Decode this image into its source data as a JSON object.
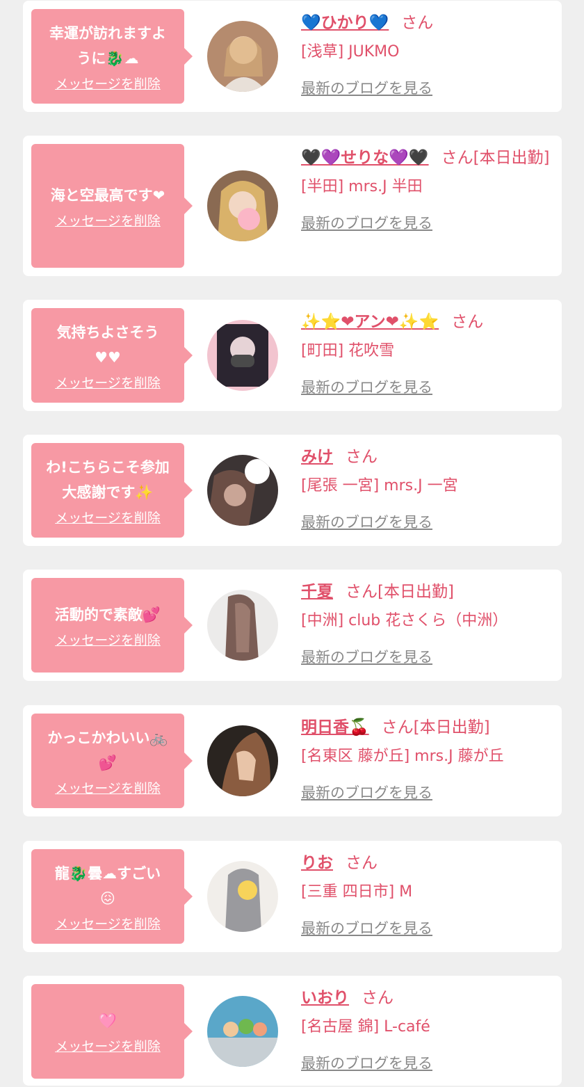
{
  "delete_label": "メッセージを削除",
  "blog_label": "最新のブログを見る",
  "items": [
    {
      "message": "幸運が訪れますよ\nうに🐉☁",
      "name": "💙ひかり💙",
      "suffix": "さん",
      "shop": "[浅草] JUKMO"
    },
    {
      "message": "海と空最高です❤",
      "name": "🖤💜せりな💜🖤",
      "suffix": "さん[本日出勤]",
      "shop": "[半田] mrs.J 半田"
    },
    {
      "message": "気持ちよさそう\n♥♥",
      "name": "✨⭐❤アン❤✨⭐",
      "suffix": "さん",
      "shop": "[町田] 花吹雪"
    },
    {
      "message": "わ!こちらこそ参加\n大感謝です✨",
      "name": "みけ",
      "suffix": "さん",
      "shop": "[尾張 一宮] mrs.J 一宮"
    },
    {
      "message": "活動的で素敵💕",
      "name": "千夏",
      "suffix": "さん[本日出勤]",
      "shop": "[中洲] club 花さくら（中洲）"
    },
    {
      "message": "かっこかわいい🚲\n💕",
      "name": "明日香🍒",
      "suffix": "さん[本日出勤]",
      "shop": "[名東区 藤が丘] mrs.J 藤が丘"
    },
    {
      "message": "龍🐉曇☁すごい\n😖",
      "name": "りお",
      "suffix": "さん",
      "shop": "[三重 四日市] M"
    },
    {
      "message": "🩷",
      "name": "いおり",
      "suffix": "さん",
      "shop": "[名古屋 錦] L-café"
    }
  ],
  "colors": {
    "bubble": "#f799a4",
    "accent": "#e0506a",
    "link_gray": "#888888",
    "background": "#efefef"
  }
}
